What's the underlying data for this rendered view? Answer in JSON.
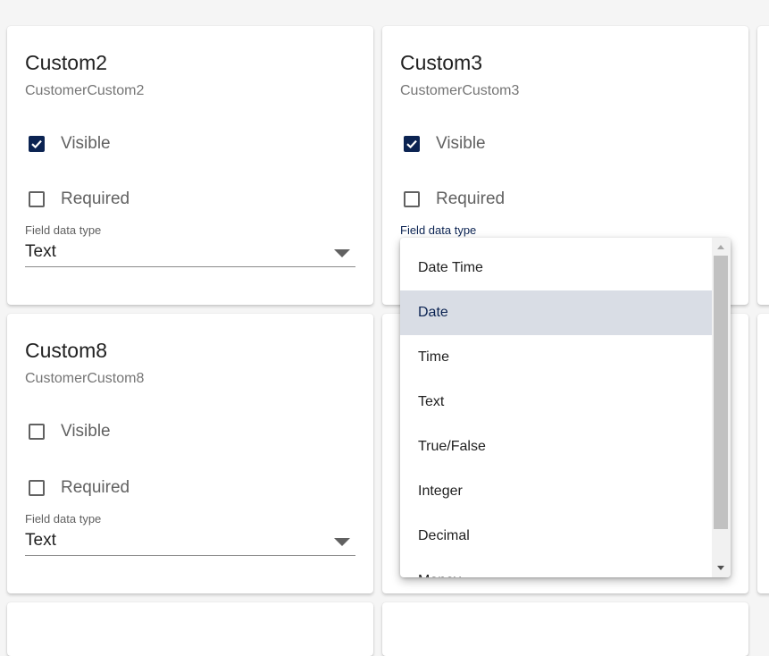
{
  "cards": [
    {
      "title": "Custom2",
      "subtitle": "CustomerCustom2",
      "visible_label": "Visible",
      "visible_checked": true,
      "required_label": "Required",
      "required_checked": false,
      "field_label": "Field data type",
      "field_value": "Text"
    },
    {
      "title": "Custom3",
      "subtitle": "CustomerCustom3",
      "visible_label": "Visible",
      "visible_checked": true,
      "required_label": "Required",
      "required_checked": false,
      "field_label": "Field data type",
      "field_value": ""
    },
    {
      "title": "Custom8",
      "subtitle": "CustomerCustom8",
      "visible_label": "Visible",
      "visible_checked": false,
      "required_label": "Required",
      "required_checked": false,
      "field_label": "Field data type",
      "field_value": "Text"
    }
  ],
  "dropdown": {
    "selected": "Date",
    "options": [
      "Date Time",
      "Date",
      "Time",
      "Text",
      "True/False",
      "Integer",
      "Decimal",
      "Money"
    ]
  },
  "icons": {
    "checkbox_checked": "checkmark-icon",
    "select_arrow": "caret-down-icon",
    "scroll_up": "scroll-up-arrow-icon",
    "scroll_down": "scroll-down-arrow-icon"
  },
  "colors": {
    "accent": "#0b2352",
    "selected_option_bg": "#d9dde5"
  }
}
